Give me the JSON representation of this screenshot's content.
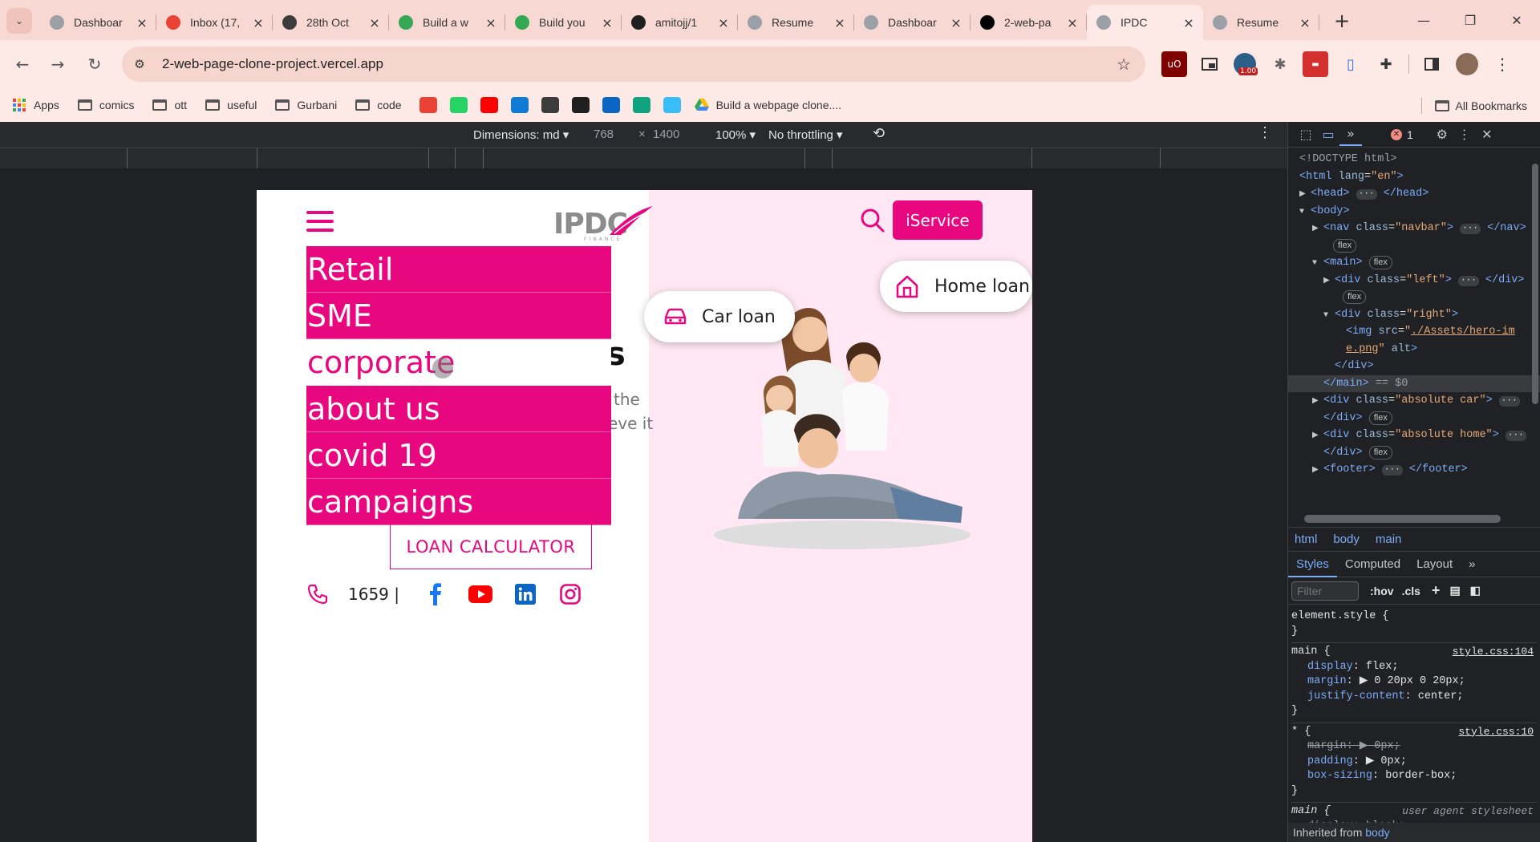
{
  "tabs": [
    {
      "title": "Dashboar",
      "favicon": "globe-icon",
      "color": "#9aa0a6",
      "active": false
    },
    {
      "title": "Inbox (17,",
      "favicon": "gmail-icon",
      "color": "#ea4335",
      "active": false
    },
    {
      "title": "28th Oct",
      "favicon": "wordpress-icon",
      "color": "#3c3c3c",
      "active": false
    },
    {
      "title": "Build a w",
      "favicon": "google-drive-icon",
      "color": "#34a853",
      "active": false
    },
    {
      "title": "Build you",
      "favicon": "google-drive-icon",
      "color": "#34a853",
      "active": false
    },
    {
      "title": "amitojj/1",
      "favicon": "github-icon",
      "color": "#1f1f1f",
      "active": false
    },
    {
      "title": "Resume",
      "favicon": "globe-icon",
      "color": "#9aa0a6",
      "active": false
    },
    {
      "title": "Dashboar",
      "favicon": "globe-icon",
      "color": "#9aa0a6",
      "active": false
    },
    {
      "title": "2-web-pa",
      "favicon": "vercel-icon",
      "color": "#000000",
      "active": false
    },
    {
      "title": "IPDC",
      "favicon": "globe-icon",
      "color": "#9aa0a6",
      "active": true
    },
    {
      "title": "Resume",
      "favicon": "globe-icon",
      "color": "#9aa0a6",
      "active": false
    }
  ],
  "toolbar": {
    "url": "2-web-page-clone-project.vercel.app",
    "ublock_badge": "1.00"
  },
  "bookmarks": {
    "items": [
      {
        "label": "Apps",
        "icon": "apps-grid-icon"
      },
      {
        "label": "comics",
        "icon": "folder-icon"
      },
      {
        "label": "ott",
        "icon": "folder-icon"
      },
      {
        "label": "useful",
        "icon": "folder-icon"
      },
      {
        "label": "Gurbani",
        "icon": "folder-icon"
      },
      {
        "label": "code",
        "icon": "folder-icon"
      }
    ],
    "icon_only": [
      {
        "icon": "gmail-icon",
        "color": "#ea4335"
      },
      {
        "icon": "whatsapp-icon",
        "color": "#25d366"
      },
      {
        "icon": "youtube-icon",
        "color": "#ff0000"
      },
      {
        "icon": "edge-icon",
        "color": "#0f7bd6"
      },
      {
        "icon": "wordpress-icon",
        "color": "#3c3c3c"
      },
      {
        "icon": "github-icon",
        "color": "#1f1f1f"
      },
      {
        "icon": "linkedin-icon",
        "color": "#0a66c2"
      },
      {
        "icon": "chatgpt-icon",
        "color": "#10a37f"
      },
      {
        "icon": "tailwind-icon",
        "color": "#38bdf8"
      }
    ],
    "drive_item": "Build a webpage clone....",
    "all_bookmarks": "All Bookmarks"
  },
  "device_toolbar": {
    "dimensions_label": "Dimensions: md",
    "width": "768",
    "times": "×",
    "height": "1400",
    "zoom": "100%",
    "throttling": "No throttling"
  },
  "site": {
    "logo_text": "IPDC",
    "logo_sub": "FINANCE",
    "iservice_label": "iService",
    "menu": [
      "Retail",
      "SME",
      "corporate",
      "about us",
      "covid 19",
      "campaigns"
    ],
    "hero_title_tail": "s",
    "hero_para_a": "the",
    "hero_para_b": "eve it",
    "loan_calculator": "LOAN CALCULATOR",
    "phone": "1659 |",
    "car_loan": "Car loan",
    "home_loan": "Home loan",
    "brand_color": "#e8077f"
  },
  "devtools": {
    "error_count": "1",
    "dom": [
      {
        "html": "<span class=\"tx\" style=\"color:#9aa0a6\">&lt;!DOCTYPE html&gt;</span>",
        "indent": 14
      },
      {
        "html": "<span class=\"tg\">&lt;html</span> <span class=\"at\">lang</span>=<span class=\"av\">\"en\"</span><span class=\"tg\">&gt;</span>",
        "indent": 14
      },
      {
        "html": "<span class=\"arrow\">▶</span><span class=\"tg\">&lt;head&gt;</span> <span class=\"ell\">···</span> <span class=\"tg\">&lt;/head&gt;</span>",
        "indent": 14
      },
      {
        "html": "<span class=\"arrow\">▼</span><span class=\"tg\">&lt;body&gt;</span>",
        "indent": 14
      },
      {
        "html": "<span class=\"arrow\">▶</span><span class=\"tg\">&lt;nav</span> <span class=\"at\">class</span>=<span class=\"av\">\"navbar\"</span><span class=\"tg\">&gt;</span> <span class=\"ell\">···</span> <span class=\"tg\">&lt;/nav&gt;</span>",
        "indent": 30
      },
      {
        "html": "<span class=\"badge\">flex</span>",
        "indent": 56
      },
      {
        "html": "<span class=\"arrow\">▼</span><span class=\"tg\">&lt;main&gt;</span> <span class=\"badge\">flex</span>",
        "indent": 30
      },
      {
        "html": "<span class=\"arrow\">▶</span><span class=\"tg\">&lt;div</span> <span class=\"at\">class</span>=<span class=\"av\">\"left\"</span><span class=\"tg\">&gt;</span> <span class=\"ell\">···</span> <span class=\"tg\">&lt;/div&gt;</span>",
        "indent": 44
      },
      {
        "html": "<span class=\"badge\">flex</span>",
        "indent": 68
      },
      {
        "html": "<span class=\"arrow\">▼</span><span class=\"tg\">&lt;div</span> <span class=\"at\">class</span>=<span class=\"av\">\"right\"</span><span class=\"tg\">&gt;</span>",
        "indent": 44
      },
      {
        "html": "<span class=\"tg\">&lt;img</span> <span class=\"at\">src</span>=<span class=\"av\">\"<u>./Assets/hero-im</u></span>",
        "indent": 72
      },
      {
        "html": "<span class=\"av\"><u>e.png</u>\"</span> <span class=\"at\">alt</span><span class=\"tg\">&gt;</span>",
        "indent": 72
      },
      {
        "html": "<span class=\"tg\">&lt;/div&gt;</span>",
        "indent": 58
      },
      {
        "html": "<span class=\"tg\">&lt;/main&gt;</span> <span style=\"color:#9aa0a6\">== $0</span>",
        "indent": 44,
        "selected": true
      },
      {
        "html": "<span class=\"arrow\">▶</span><span class=\"tg\">&lt;div</span> <span class=\"at\">class</span>=<span class=\"av\">\"absolute car\"</span><span class=\"tg\">&gt;</span> <span class=\"ell\">···</span>",
        "indent": 30
      },
      {
        "html": "<span class=\"tg\">&lt;/div&gt;</span> <span class=\"badge\">flex</span>",
        "indent": 44
      },
      {
        "html": "<span class=\"arrow\">▶</span><span class=\"tg\">&lt;div</span> <span class=\"at\">class</span>=<span class=\"av\">\"absolute home\"</span><span class=\"tg\">&gt;</span> <span class=\"ell\">···</span>",
        "indent": 30
      },
      {
        "html": "<span class=\"tg\">&lt;/div&gt;</span> <span class=\"badge\">flex</span>",
        "indent": 44
      },
      {
        "html": "<span class=\"arrow\">▶</span><span class=\"tg\">&lt;footer&gt;</span> <span class=\"ell\">···</span> <span class=\"tg\">&lt;/footer&gt;</span>",
        "indent": 30
      }
    ],
    "crumbs": [
      "html",
      "body",
      "main"
    ],
    "tabs": [
      "Styles",
      "Computed",
      "Layout"
    ],
    "filter_placeholder": "Filter",
    "hov": ":hov",
    "cls": ".cls",
    "rules": [
      {
        "selector": "element.style {",
        "source": "",
        "lines": [],
        "close": "}"
      },
      {
        "selector": "main {",
        "source": "style.css:104",
        "lines": [
          {
            "prop": "display",
            "val": "flex;"
          },
          {
            "prop": "margin",
            "val": "▶ 0 20px 0 20px;"
          },
          {
            "prop": "justify-content",
            "val": "center;"
          }
        ],
        "close": "}"
      },
      {
        "selector": "* {",
        "source": "style.css:10",
        "lines": [
          {
            "prop": "margin",
            "val": "▶ 0px;",
            "strike": true
          },
          {
            "prop": "padding",
            "val": "▶ 0px;"
          },
          {
            "prop": "box-sizing",
            "val": "border-box;"
          }
        ],
        "close": "}"
      },
      {
        "selector": "main {",
        "source": "user agent stylesheet",
        "ua": true,
        "lines": [
          {
            "prop": "display",
            "val": "block;",
            "strike": true
          }
        ],
        "close": "}"
      }
    ],
    "inherited_label": "Inherited from",
    "inherited_link": "body"
  }
}
